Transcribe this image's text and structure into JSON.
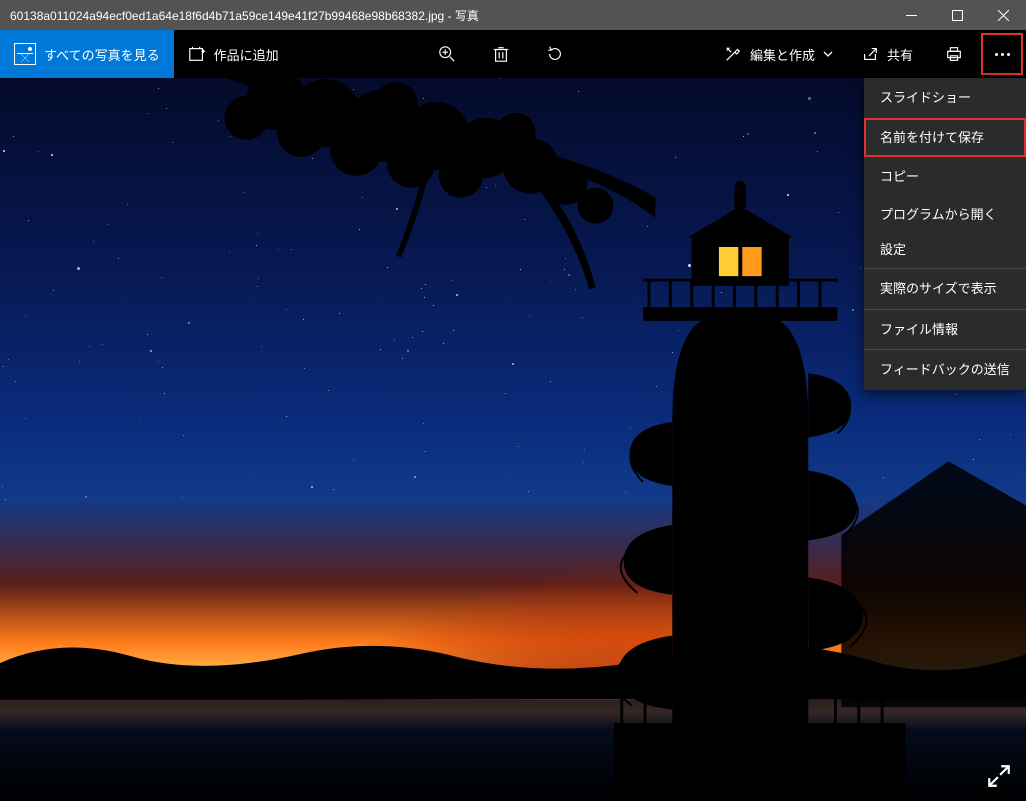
{
  "titlebar": {
    "title": "60138a011024a94ecf0ed1a64e18f6d4b71a59ce149e41f27b99468e98b68382.jpg - 写真"
  },
  "toolbar": {
    "see_all": "すべての写真を見る",
    "add_to_creation": "作品に追加",
    "edit_create": "編集と作成",
    "share": "共有"
  },
  "menu": {
    "slideshow": "スライドショー",
    "save_as": "名前を付けて保存",
    "copy": "コピー",
    "open_with": "プログラムから開く",
    "settings": "設定",
    "actual_size": "実際のサイズで表示",
    "file_info": "ファイル情報",
    "feedback": "フィードバックの送信"
  }
}
